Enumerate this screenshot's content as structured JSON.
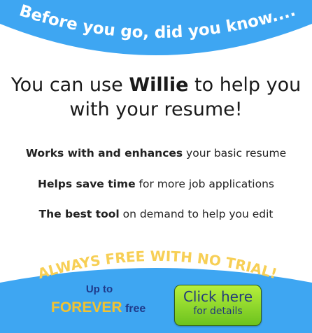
{
  "banner": {
    "title": "Before you go, did you know...."
  },
  "headline": {
    "prefix": "You can use ",
    "product": "Willie",
    "suffix_line1": " to help you",
    "line2": "with your resume!"
  },
  "features": [
    {
      "bold": "Works with and enhances",
      "rest": " your basic resume"
    },
    {
      "bold": "Helps save time",
      "rest": " for more job applications"
    },
    {
      "bold": "The best tool",
      "rest": " on demand to help you edit"
    }
  ],
  "promo": {
    "arc_text": "ALWAYS FREE WITH NO TRIAL!",
    "up_to": "Up to",
    "forever": "FOREVER",
    "free": "free"
  },
  "cta": {
    "line1": "Click here",
    "line2": "for details"
  },
  "colors": {
    "banner_blue": "#3ea6f2",
    "promo_yellow": "#f7cf55",
    "cta_green": "#8fd92a",
    "text_navy": "#1f3a8a"
  }
}
